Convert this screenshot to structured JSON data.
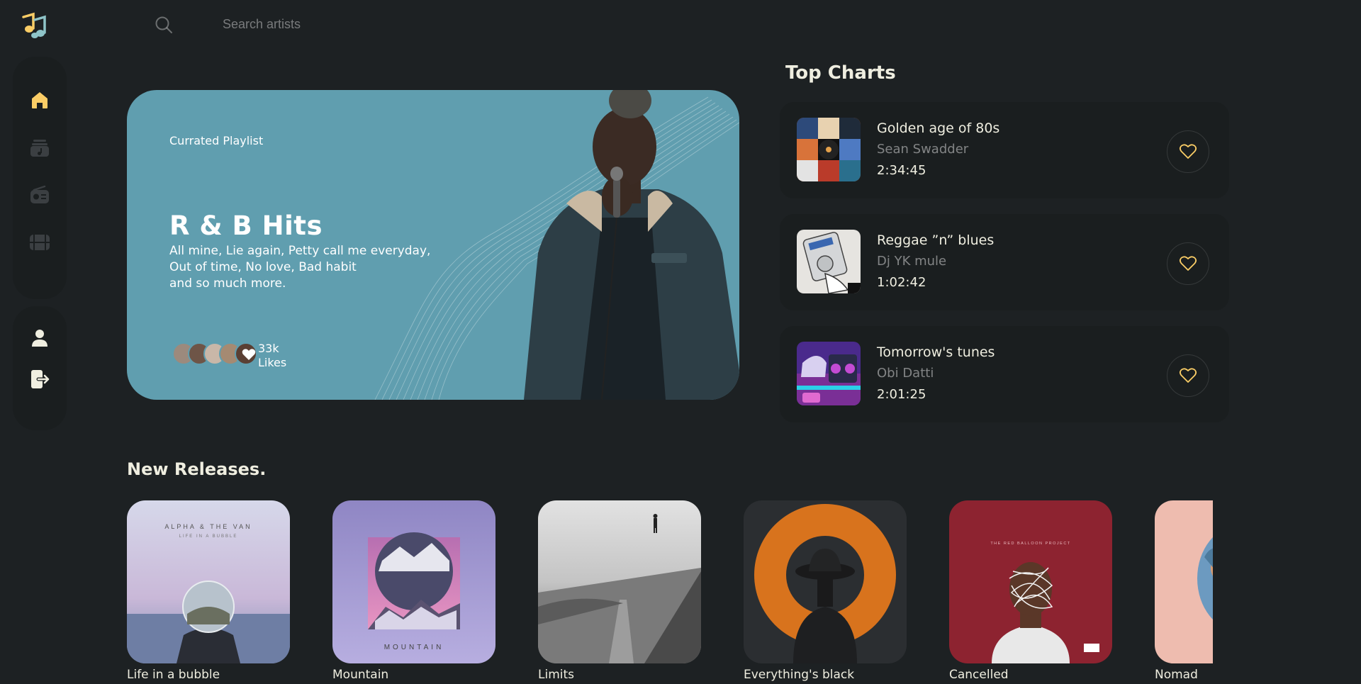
{
  "search": {
    "placeholder": "Search artists"
  },
  "sidebar": {
    "items": [
      {
        "icon": "home-icon",
        "active": true
      },
      {
        "icon": "music-library-icon"
      },
      {
        "icon": "radio-icon"
      },
      {
        "icon": "video-icon"
      }
    ],
    "bottom_items": [
      {
        "icon": "profile-icon"
      },
      {
        "icon": "logout-icon"
      }
    ]
  },
  "hero": {
    "eyebrow": "Currated Playlist",
    "title": "R & B Hits",
    "description_lines": [
      "All mine, Lie again, Petty call me everyday,",
      "Out of time, No love, Bad habit",
      "and so much more."
    ],
    "likes_count": "33k",
    "likes_label": "Likes"
  },
  "top_charts": {
    "title": "Top Charts",
    "items": [
      {
        "title": "Golden age of 80s",
        "artist": "Sean Swadder",
        "duration": "2:34:45"
      },
      {
        "title": "Reggae ”n” blues",
        "artist": "Dj YK mule",
        "duration": "1:02:42"
      },
      {
        "title": "Tomorrow's tunes",
        "artist": "Obi Datti",
        "duration": "2:01:25"
      }
    ]
  },
  "new_releases": {
    "title": "New Releases.",
    "items": [
      {
        "title": "Life in a bubble",
        "cover_text": [
          "ALPHA & THE VAN",
          "LIFE IN A BUBBLE"
        ]
      },
      {
        "title": "Mountain",
        "cover_text": [
          "MOUNTAIN"
        ]
      },
      {
        "title": "Limits"
      },
      {
        "title": "Everything's black"
      },
      {
        "title": "Cancelled",
        "cover_text": [
          "THE RED BALLOON PROJECT"
        ]
      },
      {
        "title": "Nomad"
      }
    ]
  },
  "colors": {
    "background": "#1d2123",
    "panel": "#1a1e1f",
    "accent": "#facd66",
    "hero_bg": "#609eaf"
  }
}
